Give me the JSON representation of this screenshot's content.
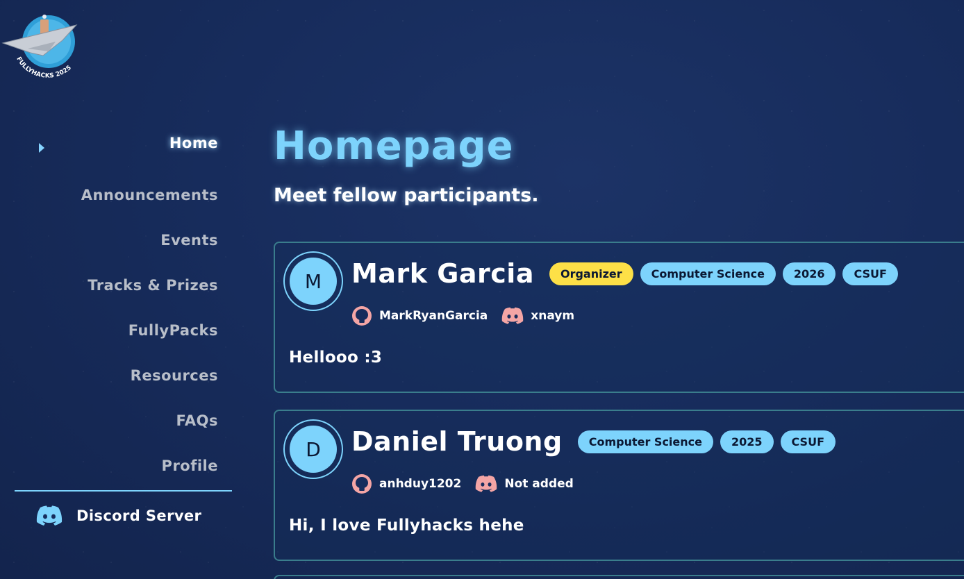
{
  "logo": {
    "text": "FULLYHACKS 2025",
    "icon": "jet-plane-logo-icon"
  },
  "sidebar": {
    "items": [
      {
        "label": "Home",
        "active": true
      },
      {
        "label": "Announcements",
        "active": false
      },
      {
        "label": "Events",
        "active": false
      },
      {
        "label": "Tracks & Prizes",
        "active": false
      },
      {
        "label": "FullyPacks",
        "active": false
      },
      {
        "label": "Resources",
        "active": false
      },
      {
        "label": "FAQs",
        "active": false
      },
      {
        "label": "Profile",
        "active": false
      }
    ],
    "discord": {
      "label": "Discord Server",
      "icon": "discord-icon"
    }
  },
  "main": {
    "title": "Homepage",
    "subtitle": "Meet fellow participants."
  },
  "participants": [
    {
      "initial": "M",
      "name": "Mark Garcia",
      "tags": [
        "Organizer",
        "Computer Science",
        "2026",
        "CSUF"
      ],
      "github": "MarkRyanGarcia",
      "discord": "xnaym",
      "bio": "Hellooo :3"
    },
    {
      "initial": "D",
      "name": "Daniel Truong",
      "tags": [
        "Computer Science",
        "2025",
        "CSUF"
      ],
      "github": "anhduy1202",
      "discord": "Not added",
      "bio": "Hi, I love Fullyhacks hehe"
    }
  ],
  "colors": {
    "background": "#172c5c",
    "accent": "#7dd3fc",
    "organizer_tag": "#fde047",
    "social_icon": "#f4a5a5",
    "card_border": "#3a7d8c"
  }
}
